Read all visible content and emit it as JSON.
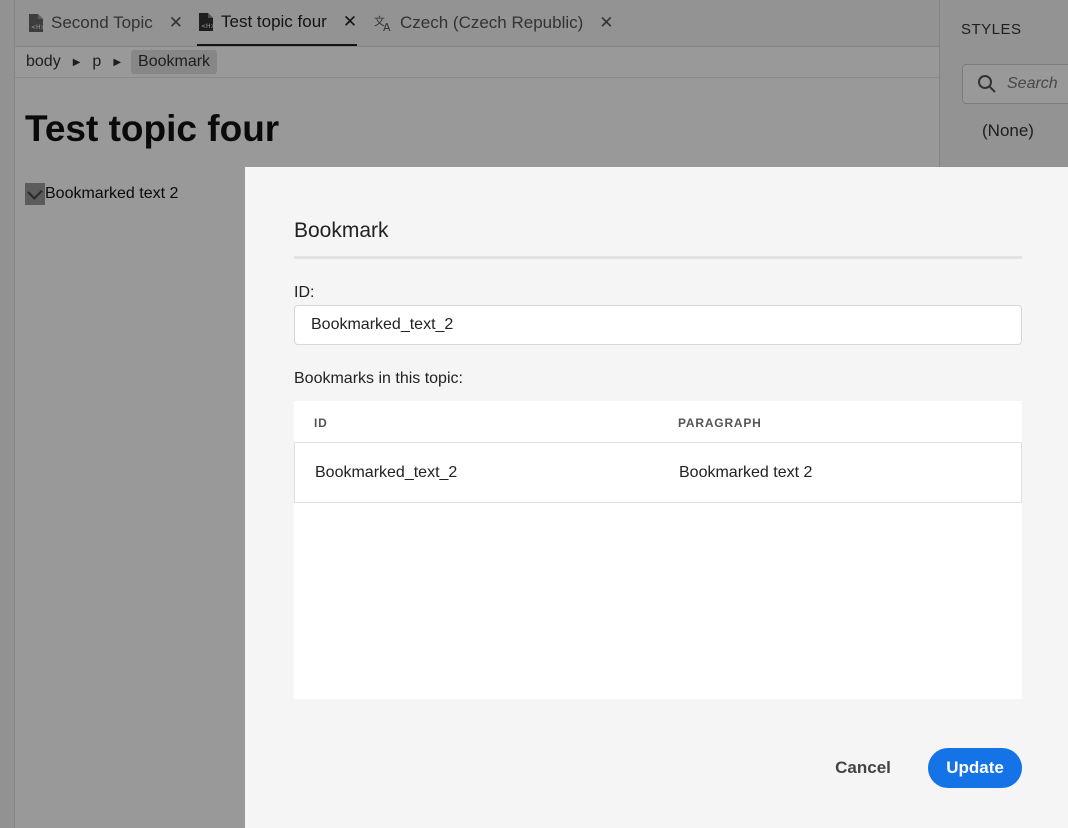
{
  "tabs": [
    {
      "label": "Second Topic",
      "icon": "dita-file-icon",
      "active": false
    },
    {
      "label": "Test topic four",
      "icon": "dita-file-icon",
      "active": true
    },
    {
      "label": "Czech (Czech Republic)",
      "icon": "translate-icon",
      "active": false
    }
  ],
  "breadcrumb": [
    "body",
    "p",
    "Bookmark"
  ],
  "document": {
    "title": "Test topic four",
    "paragraph": "Bookmarked text 2"
  },
  "styles_panel": {
    "heading": "STYLES",
    "search_placeholder": "Search",
    "item": "(None)"
  },
  "dialog": {
    "title": "Bookmark",
    "id_label": "ID:",
    "id_value": "Bookmarked_text_2",
    "list_label": "Bookmarks in this topic:",
    "columns": [
      "ID",
      "PARAGRAPH"
    ],
    "rows": [
      {
        "id": "Bookmarked_text_2",
        "paragraph": "Bookmarked text 2"
      }
    ],
    "cancel_label": "Cancel",
    "update_label": "Update"
  },
  "colors": {
    "accent": "#1473e6"
  }
}
